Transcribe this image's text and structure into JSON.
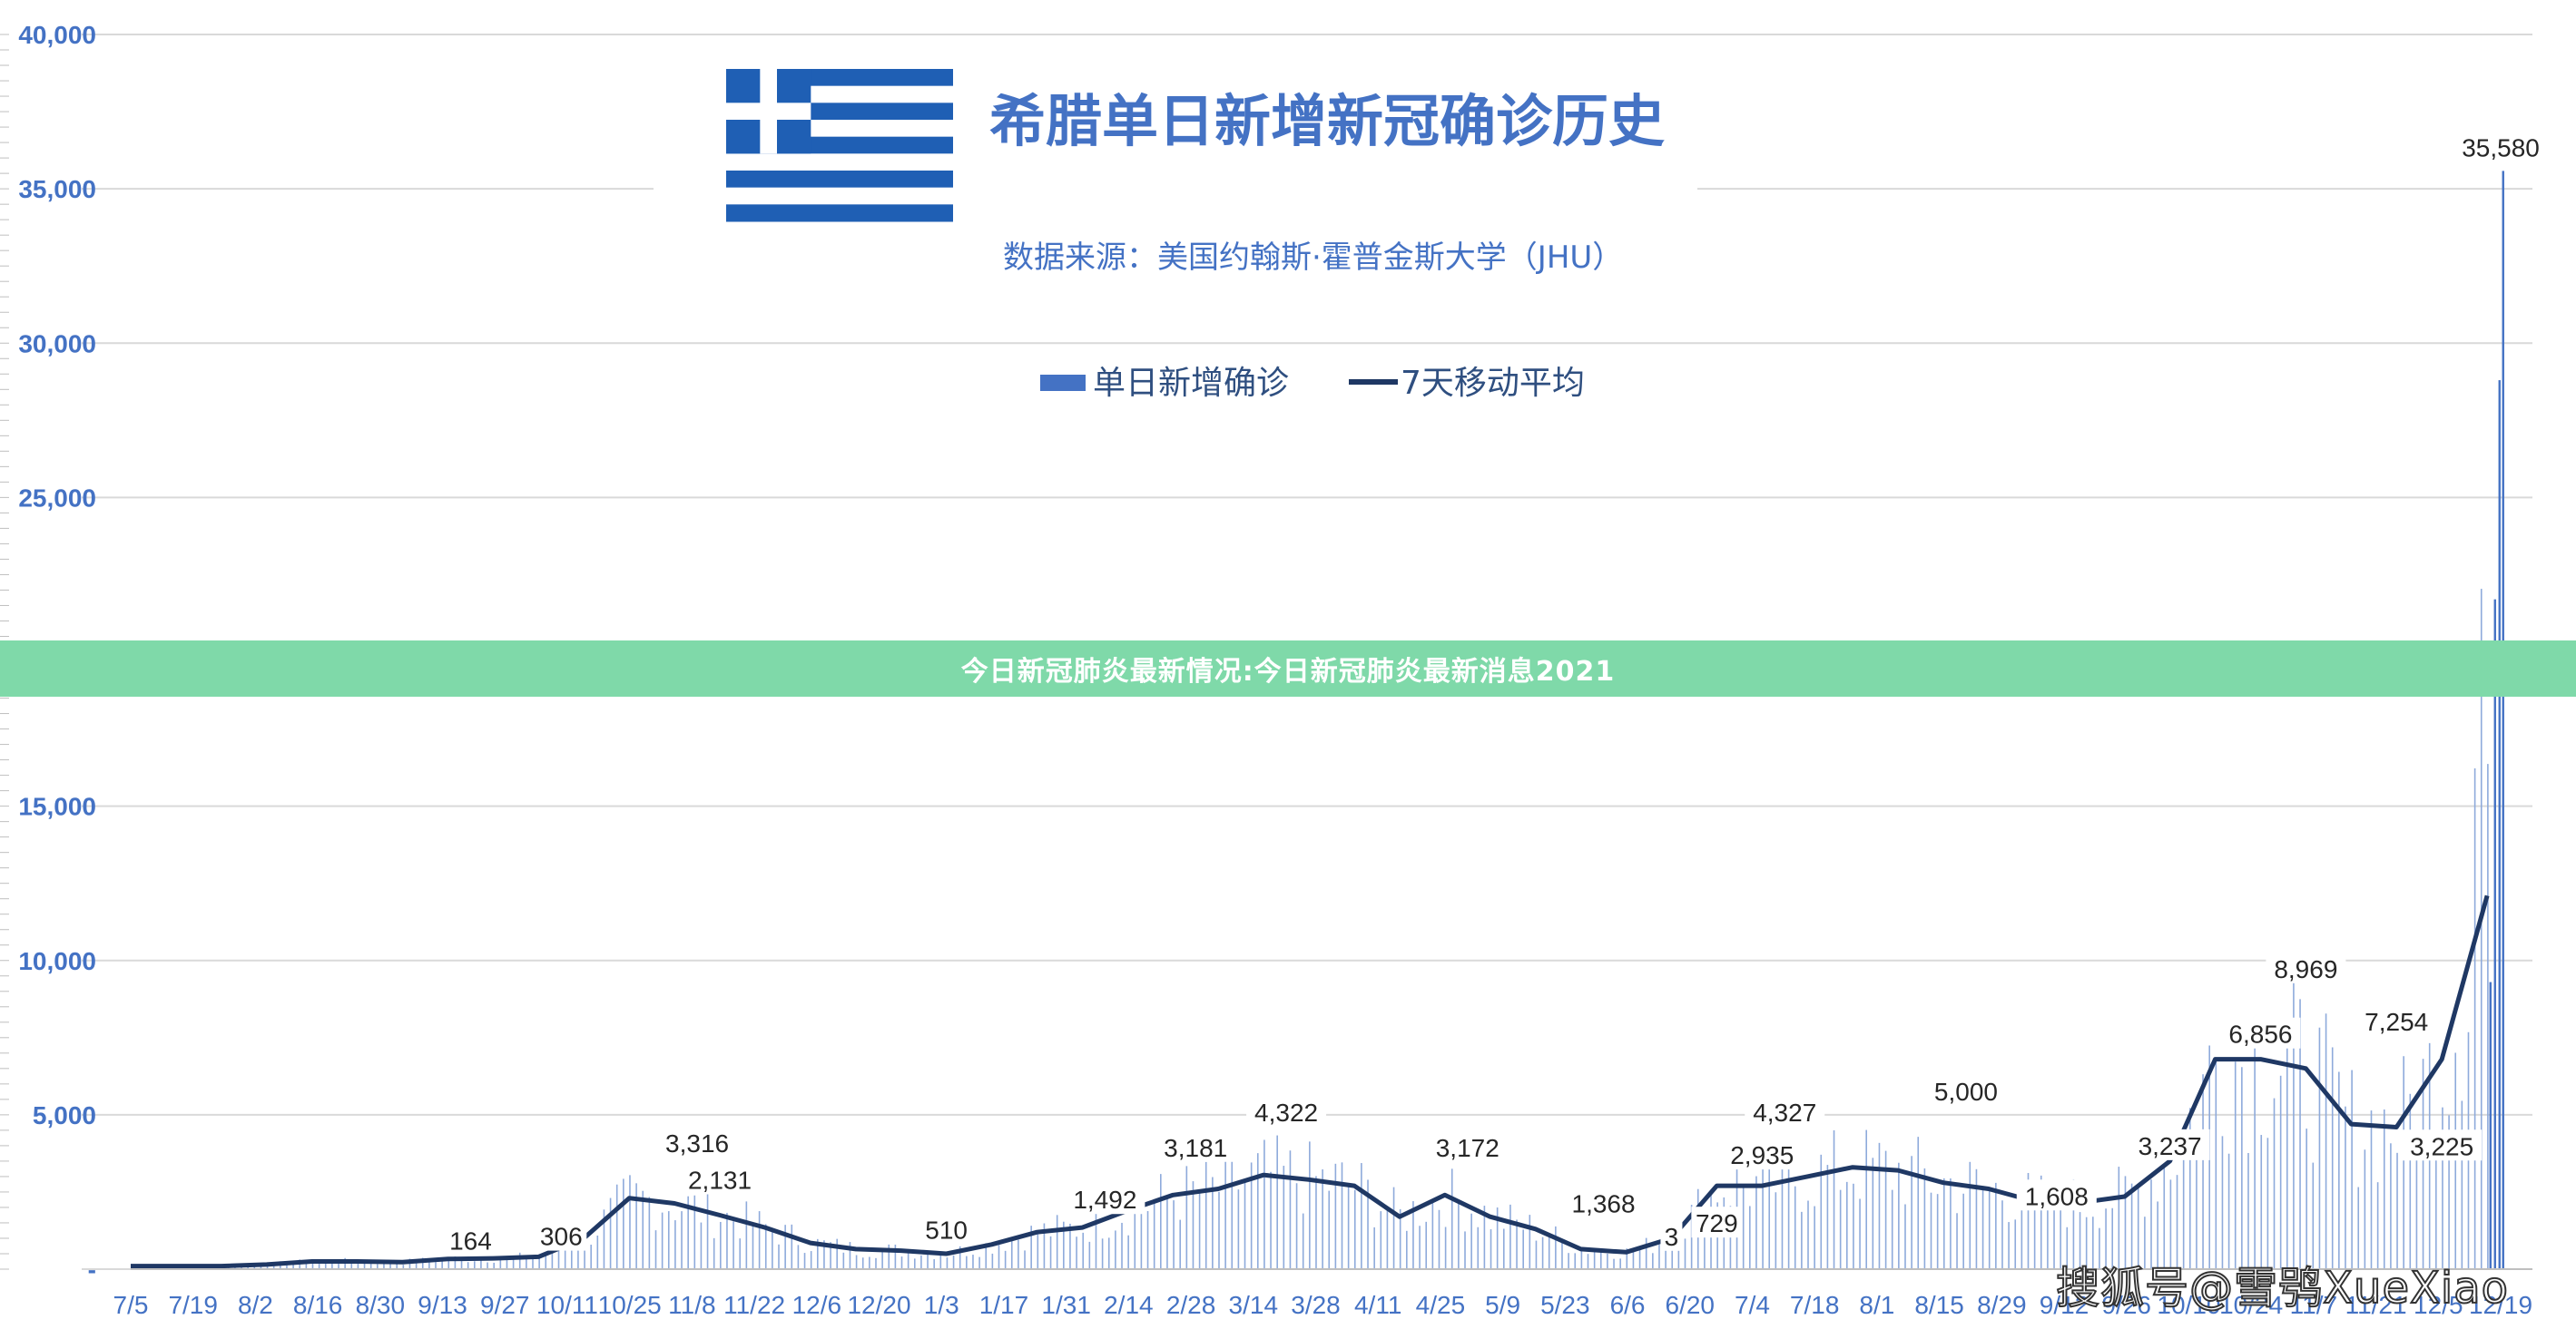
{
  "chart_data": {
    "type": "bar",
    "title": "希腊单日新增新冠确诊历史",
    "subtitle": "数据来源：美国约翰斯·霍普金斯大学（JHU）",
    "legend": [
      {
        "name": "单日新增确诊",
        "kind": "bar",
        "color": "#4472c4"
      },
      {
        "name": "7天移动平均",
        "kind": "line",
        "color": "#1f3864"
      }
    ],
    "ylim": [
      0,
      40000
    ],
    "ytick_labels": [
      "-",
      "5,000",
      "10,000",
      "15,000",
      "20,000",
      "25,000",
      "30,000",
      "35,000",
      "40,000"
    ],
    "xtick_labels": [
      "7/5",
      "7/19",
      "8/2",
      "8/16",
      "8/30",
      "9/13",
      "9/27",
      "10/11",
      "10/25",
      "11/8",
      "11/22",
      "12/6",
      "12/20",
      "1/3",
      "1/17",
      "1/31",
      "2/14",
      "2/28",
      "3/14",
      "3/28",
      "4/11",
      "4/25",
      "5/9",
      "5/23",
      "6/6",
      "6/20",
      "7/4",
      "7/18",
      "8/1",
      "8/15",
      "8/29",
      "9/12",
      "9/26",
      "10/10",
      "10/24",
      "11/7",
      "11/21",
      "12/5",
      "12/19"
    ],
    "grid": true,
    "legend_position": "top",
    "series": [
      {
        "name": "7天移动平均",
        "points": [
          [
            0,
            100
          ],
          [
            1,
            100
          ],
          [
            2,
            100
          ],
          [
            3,
            150
          ],
          [
            4,
            250
          ],
          [
            5,
            250
          ],
          [
            6,
            230
          ],
          [
            7,
            330
          ],
          [
            8,
            350
          ],
          [
            9,
            400
          ],
          [
            10,
            1000
          ],
          [
            11,
            2300
          ],
          [
            12,
            2131
          ],
          [
            13,
            1750
          ],
          [
            14,
            1350
          ],
          [
            15,
            850
          ],
          [
            16,
            650
          ],
          [
            17,
            600
          ],
          [
            18,
            500
          ],
          [
            19,
            800
          ],
          [
            20,
            1200
          ],
          [
            21,
            1350
          ],
          [
            22,
            1900
          ],
          [
            23,
            2400
          ],
          [
            24,
            2600
          ],
          [
            25,
            3050
          ],
          [
            26,
            2900
          ],
          [
            27,
            2700
          ],
          [
            28,
            1700
          ],
          [
            29,
            2400
          ],
          [
            30,
            1700
          ],
          [
            31,
            1300
          ],
          [
            32,
            650
          ],
          [
            33,
            550
          ],
          [
            34,
            1000
          ],
          [
            35,
            2700
          ],
          [
            36,
            2700
          ],
          [
            37,
            3000
          ],
          [
            38,
            3300
          ],
          [
            39,
            3200
          ],
          [
            40,
            2800
          ],
          [
            41,
            2600
          ],
          [
            42,
            2200
          ],
          [
            43,
            2150
          ],
          [
            44,
            2350
          ],
          [
            45,
            3500
          ],
          [
            46,
            6800
          ],
          [
            47,
            6800
          ],
          [
            48,
            6500
          ],
          [
            49,
            4700
          ],
          [
            50,
            4600
          ],
          [
            51,
            6800
          ],
          [
            52,
            12100
          ]
        ]
      }
    ],
    "annotations": [
      {
        "text": "164",
        "x": 7.5,
        "y": 164
      },
      {
        "text": "306",
        "x": 9.5,
        "y": 306
      },
      {
        "text": "3,316",
        "x": 12.5,
        "y": 3316
      },
      {
        "text": "2,131",
        "x": 13,
        "y": 2131
      },
      {
        "text": "510",
        "x": 18,
        "y": 510
      },
      {
        "text": "1,492",
        "x": 21.5,
        "y": 1492
      },
      {
        "text": "3,181",
        "x": 23.5,
        "y": 3181
      },
      {
        "text": "4,322",
        "x": 25.5,
        "y": 4322
      },
      {
        "text": "3,172",
        "x": 29.5,
        "y": 3172
      },
      {
        "text": "1,368",
        "x": 32.5,
        "y": 1368
      },
      {
        "text": "3",
        "x": 34,
        "y": 300
      },
      {
        "text": "729",
        "x": 35,
        "y": 729
      },
      {
        "text": "2,935",
        "x": 36,
        "y": 2935
      },
      {
        "text": "4,327",
        "x": 36.5,
        "y": 4327
      },
      {
        "text": "5,000",
        "x": 40.5,
        "y": 5000
      },
      {
        "text": "1,608",
        "x": 42.5,
        "y": 1608
      },
      {
        "text": "3,237",
        "x": 45,
        "y": 3237
      },
      {
        "text": "6,856",
        "x": 47,
        "y": 6856
      },
      {
        "text": "8,969",
        "x": 48,
        "y": 8969
      },
      {
        "text": "7,254",
        "x": 50,
        "y": 7254
      },
      {
        "text": "3,225",
        "x": 51,
        "y": 3225
      },
      {
        "text": "35,580",
        "x": 52.3,
        "y": 35580
      }
    ]
  },
  "banner": {
    "text": "今日新冠肺炎最新情况:今日新冠肺炎最新消息2021"
  },
  "watermark": {
    "text": "搜狐号@雪鸮XueXiao"
  }
}
